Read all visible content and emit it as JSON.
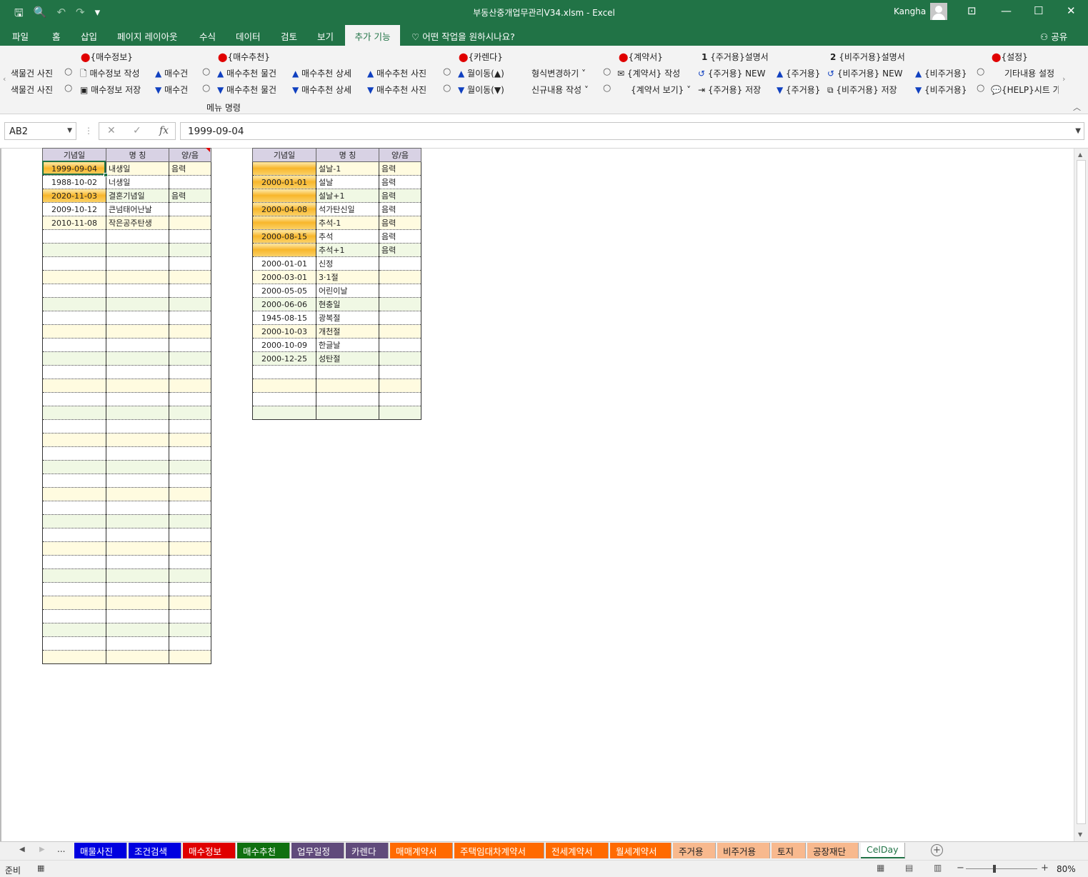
{
  "window": {
    "title": "부동산중개업무관리V34.xlsm  -  Excel",
    "user": "Kangha",
    "min_icon": "minimize-icon",
    "max_icon": "maximize-icon",
    "close_icon": "close-icon"
  },
  "quick_access": {
    "save": "🖫",
    "preview": "🔍",
    "undo": "↶",
    "redo": "↷",
    "customize": "▾"
  },
  "ribbon_tabs": [
    "파일",
    "홈",
    "삽입",
    "페이지 레이아웃",
    "수식",
    "데이터",
    "검토",
    "보기"
  ],
  "active_tab": "추가 기능",
  "tell_me": "어떤 작업을 원하시나요?",
  "share": "공유",
  "ribbon": {
    "headers": {
      "buyinfo": "{매수정보}",
      "recommend": "{매수추천}",
      "calendar": "{카렌다}",
      "contract": "{계약서}",
      "res_manual_num": "1",
      "res_manual": "{주거용}설명서",
      "nonres_manual_num": "2",
      "nonres_manual": "{비주거용}설명서",
      "settings": "{설정}"
    },
    "row1": {
      "photo": "색물건 사진",
      "buyinfo_create": "매수정보 작성",
      "buy_count": "매수건",
      "rec_item": "매수추천 물건",
      "rec_detail": "매수추천 상세",
      "rec_photo": "매수추천 사진",
      "month_move": "월이동(▲)",
      "format_change": "형식변경하기 ˅",
      "contract_create": "{계약서} 작성",
      "res_new": "{주거용} NEW",
      "res": "{주거용}",
      "nonres_new": "{비주거용} NEW",
      "nonres": "{비주거용}",
      "other_settings": "기타내용 설정"
    },
    "row2": {
      "photo": "색물건 사진",
      "buyinfo_save": "매수정보 저장",
      "buy_count": "매수건",
      "rec_item": "매수추천 물건",
      "rec_detail": "매수추천 상세",
      "rec_photo": "매수추천 사진",
      "month_move": "월이동(▼)",
      "new_content": "신규내용 작성 ˅",
      "contract_view": "{계약서 보기} ˅",
      "res_save": "{주거용} 저장",
      "res": "{주거용}",
      "nonres_save": "{비주거용} 저장",
      "nonres": "{비주거용}",
      "help": "{HELP}시트 가기"
    },
    "group_label": "메뉴 명령"
  },
  "formula_bar": {
    "name_box": "AB2",
    "cancel": "✕",
    "enter": "✓",
    "fx": "fx",
    "value": "1999-09-04"
  },
  "table1": {
    "headers": [
      "기념일",
      "명    칭",
      "양/음"
    ],
    "rows": [
      [
        "1999-09-04",
        "내생일",
        "음력",
        true
      ],
      [
        "1988-10-02",
        "너생일",
        "",
        false
      ],
      [
        "2020-11-03",
        "결혼기념일",
        "음력",
        true
      ],
      [
        "2009-10-12",
        "큰넘태어난날",
        "",
        false
      ],
      [
        "2010-11-08",
        "작은공주탄생",
        "",
        false
      ]
    ],
    "total_rows": 37
  },
  "table2": {
    "headers": [
      "기념일",
      "명    칭",
      "양/음"
    ],
    "rows": [
      [
        "",
        "설날-1",
        "음력",
        true
      ],
      [
        "2000-01-01",
        "설날",
        "음력",
        true
      ],
      [
        "",
        "설날+1",
        "음력",
        true
      ],
      [
        "2000-04-08",
        "석가탄신일",
        "음력",
        true
      ],
      [
        "",
        "추석-1",
        "음력",
        true
      ],
      [
        "2000-08-15",
        "추석",
        "음력",
        true
      ],
      [
        "",
        "추석+1",
        "음력",
        true
      ],
      [
        "2000-01-01",
        "신정",
        "",
        false
      ],
      [
        "2000-03-01",
        "3·1절",
        "",
        false
      ],
      [
        "2000-05-05",
        "어린이날",
        "",
        false
      ],
      [
        "2000-06-06",
        "현충일",
        "",
        false
      ],
      [
        "1945-08-15",
        "광복절",
        "",
        false
      ],
      [
        "2000-10-03",
        "개천절",
        "",
        false
      ],
      [
        "2000-10-09",
        "한글날",
        "",
        false
      ],
      [
        "2000-12-25",
        "성탄절",
        "",
        false
      ]
    ],
    "total_rows": 19
  },
  "sheet_tabs": [
    {
      "label": "매물사진",
      "color": "#0000e0"
    },
    {
      "label": "조건검색",
      "color": "#0000e0"
    },
    {
      "label": "매수정보",
      "color": "#e00000"
    },
    {
      "label": "매수추천",
      "color": "#107010"
    },
    {
      "label": "업무일정",
      "color": "#604a7b"
    },
    {
      "label": "카렌다",
      "color": "#604a7b"
    },
    {
      "label": "매매계약서",
      "color": "#ff6a00"
    },
    {
      "label": "주택임대차계약서",
      "color": "#ff6a00"
    },
    {
      "label": "전세계약서",
      "color": "#ff6a00"
    },
    {
      "label": "월세계약서",
      "color": "#ff6a00"
    },
    {
      "label": "주거용",
      "color": "#f8b98e"
    },
    {
      "label": "비주거용",
      "color": "#f8b98e"
    },
    {
      "label": "토지",
      "color": "#f8b98e"
    },
    {
      "label": "공장재단",
      "color": "#f8b98e"
    }
  ],
  "active_sheet": "CelDay",
  "tab_nav": {
    "prev": "◀",
    "next": "▶",
    "more": "..."
  },
  "status": {
    "ready": "준비",
    "zoom": "80%"
  }
}
